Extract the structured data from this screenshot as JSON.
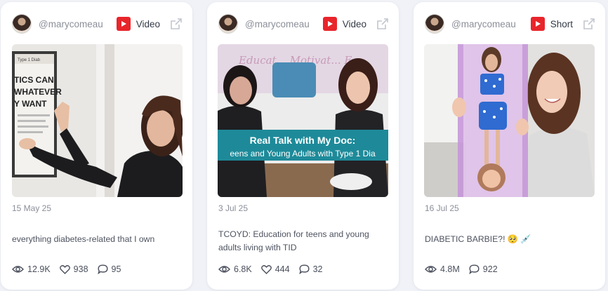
{
  "cards": [
    {
      "handle": "@marycomeau",
      "type": "Video",
      "date": "15 May 25",
      "caption": "everything diabetes-related that I own",
      "views": "12.9K",
      "likes": "938",
      "comments": "95",
      "thumb_text": [
        "TICS CAN",
        "WHATEVER",
        "Y WANT"
      ],
      "thumb_header": "Type 1 Diab"
    },
    {
      "handle": "@marycomeau",
      "type": "Video",
      "date": "3 Jul 25",
      "caption": "TCOYD: Education for teens and young adults living with TID",
      "views": "6.8K",
      "likes": "444",
      "comments": "32",
      "thumb_banner_line1": "Real Talk with My Doc:",
      "thumb_banner_line2": "eens and Young Adults with Type 1 Dia",
      "thumb_wall_text": "Educat... Motivat... E..."
    },
    {
      "handle": "@marycomeau",
      "type": "Short",
      "date": "16 Jul 25",
      "caption": "DIABETIC BARBIE?! 🥺 💉",
      "views": "4.8M",
      "comments": "922"
    }
  ],
  "colors": {
    "youtube_red": "#e8252b",
    "banner_teal": "#1e8a99",
    "page_bg": "#f0f2f7"
  },
  "icons": {
    "platform": "youtube-icon",
    "external": "external-link-icon",
    "views": "eye-icon",
    "likes": "heart-icon",
    "comments": "comment-icon"
  }
}
